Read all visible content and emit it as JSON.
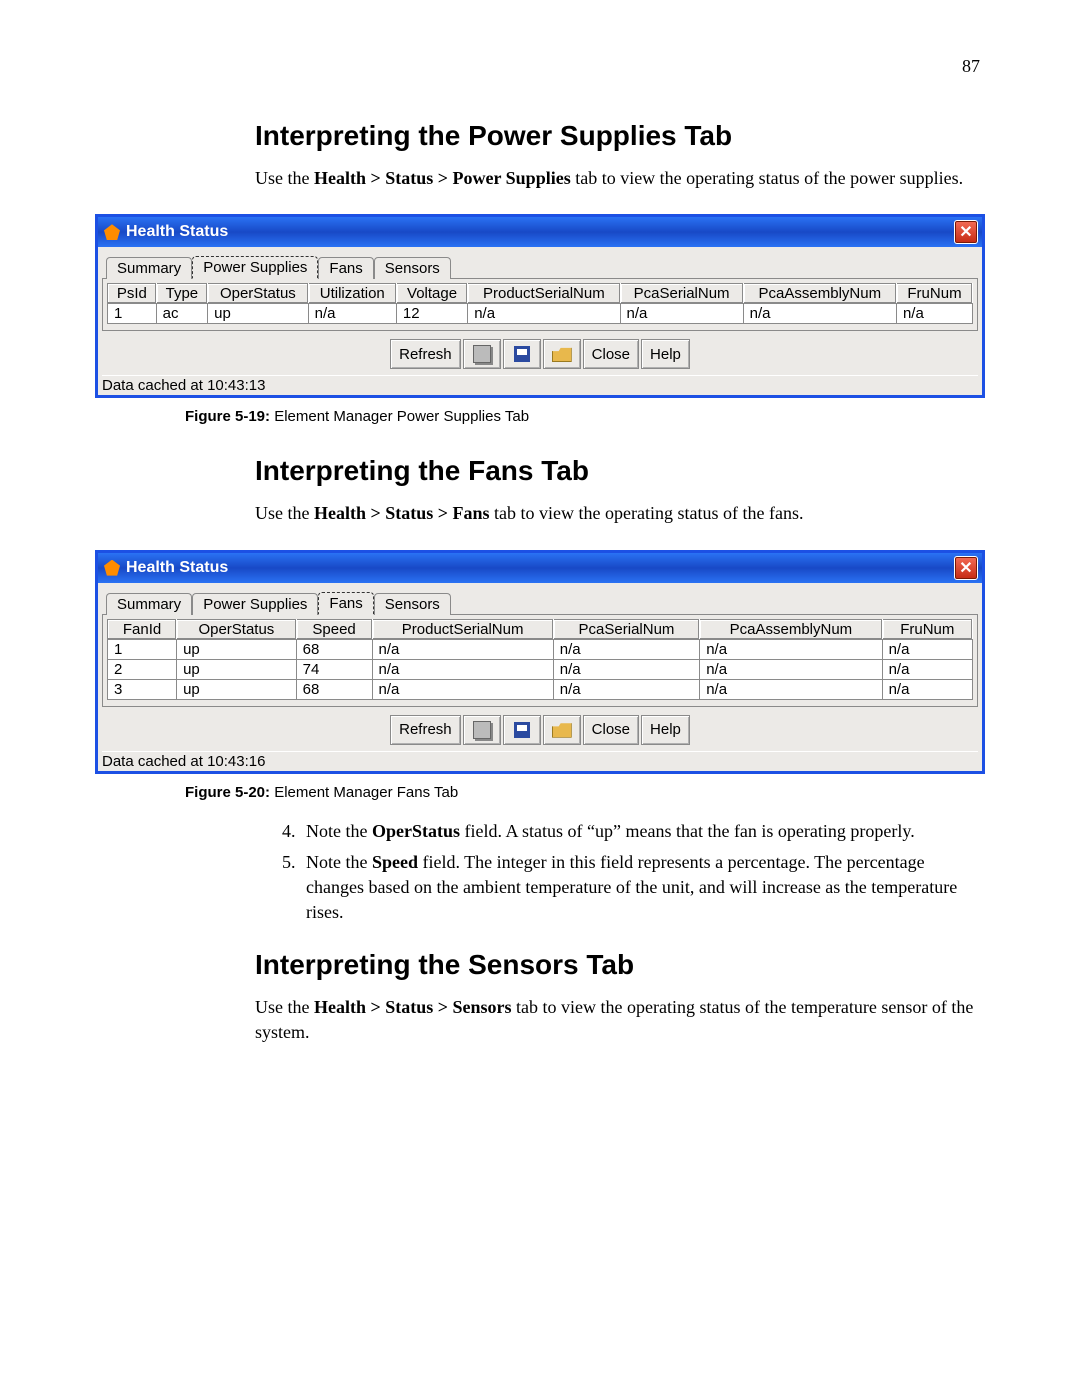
{
  "page_number": "87",
  "section1": {
    "heading": "Interpreting the Power Supplies Tab",
    "intro_pre": "Use the ",
    "intro_bold": "Health > Status > Power Supplies",
    "intro_post": " tab to view the operating status of the power supplies."
  },
  "section2": {
    "heading": "Interpreting the Fans Tab",
    "intro_pre": "Use the ",
    "intro_bold": "Health > Status > Fans",
    "intro_post": " tab to view the operating status of the fans."
  },
  "section3": {
    "heading": "Interpreting the Sensors Tab",
    "intro_pre": "Use the ",
    "intro_bold": "Health > Status > Sensors",
    "intro_post": " tab to view the operating status of the temperature sensor of the system."
  },
  "window_common": {
    "title": "Health Status",
    "tabs": {
      "summary": "Summary",
      "power": "Power Supplies",
      "fans": "Fans",
      "sensors": "Sensors"
    },
    "buttons": {
      "refresh": "Refresh",
      "close": "Close",
      "help": "Help"
    }
  },
  "win_power": {
    "headers": [
      "PsId",
      "Type",
      "OperStatus",
      "Utilization",
      "Voltage",
      "ProductSerialNum",
      "PcaSerialNum",
      "PcaAssemblyNum",
      "FruNum"
    ],
    "rows": [
      [
        "1",
        "ac",
        "up",
        "n/a",
        "12",
        "n/a",
        "n/a",
        "n/a",
        "n/a"
      ]
    ],
    "status": "Data cached at 10:43:13"
  },
  "win_fans": {
    "headers": [
      "FanId",
      "OperStatus",
      "Speed",
      "ProductSerialNum",
      "PcaSerialNum",
      "PcaAssemblyNum",
      "FruNum"
    ],
    "rows": [
      [
        "1",
        "up",
        "68",
        "n/a",
        "n/a",
        "n/a",
        "n/a"
      ],
      [
        "2",
        "up",
        "74",
        "n/a",
        "n/a",
        "n/a",
        "n/a"
      ],
      [
        "3",
        "up",
        "68",
        "n/a",
        "n/a",
        "n/a",
        "n/a"
      ]
    ],
    "status": "Data cached at 10:43:16"
  },
  "fig19": {
    "label": "Figure 5-19:",
    "text": " Element Manager Power Supplies Tab"
  },
  "fig20": {
    "label": "Figure 5-20:",
    "text": " Element Manager Fans Tab"
  },
  "notes": {
    "n4_pre": "Note the ",
    "n4_bold": "OperStatus",
    "n4_post": " field. A status of “up” means that the fan is operating properly.",
    "n5_pre": "Note the ",
    "n5_bold": "Speed",
    "n5_post": " field. The integer in this field represents a percentage. The percentage changes based on the ambient temperature of the unit, and will increase as the temperature rises."
  }
}
